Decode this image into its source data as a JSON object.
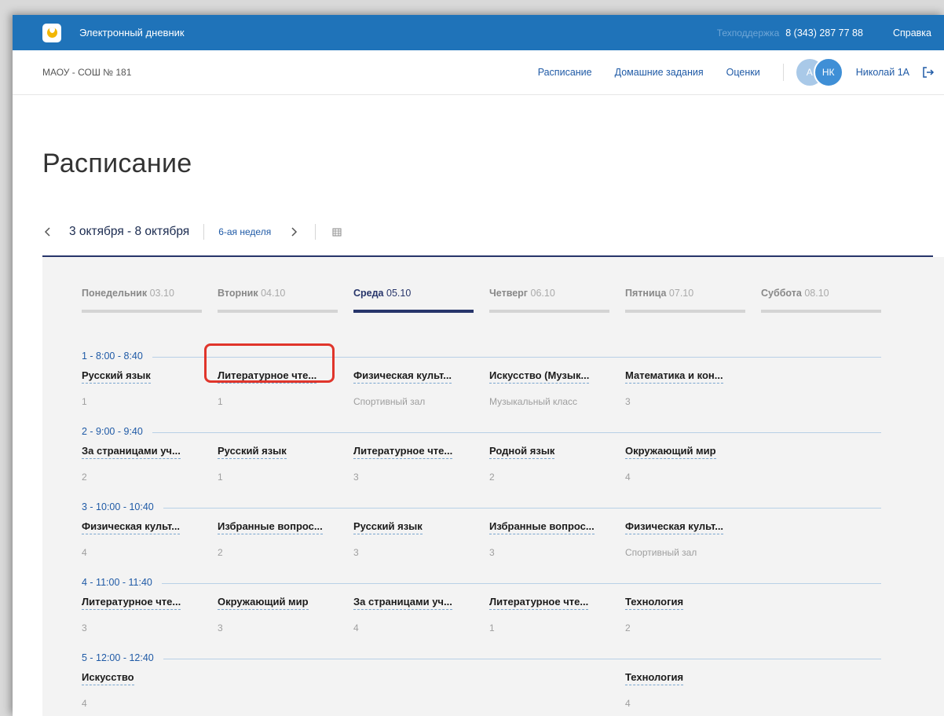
{
  "header": {
    "app_title": "Электронный дневник",
    "support_label": "Техподдержка",
    "support_phone": "8 (343) 287 77 88",
    "help_label": "Справка",
    "brand_color": "#1f73b9"
  },
  "subheader": {
    "school": "МАОУ - СОШ № 181",
    "nav": [
      "Расписание",
      "Домашние задания",
      "Оценки"
    ],
    "avatar_a": "А",
    "avatar_nk": "НК",
    "user_name": "Николай 1А"
  },
  "page": {
    "title": "Расписание",
    "date_range": "3 октября - 8 октября",
    "week_label": "6-ая неделя"
  },
  "days": [
    {
      "name": "Понедельник",
      "date": "03.10"
    },
    {
      "name": "Вторник",
      "date": "04.10"
    },
    {
      "name": "Среда",
      "date": "05.10"
    },
    {
      "name": "Четверг",
      "date": "06.10"
    },
    {
      "name": "Пятница",
      "date": "07.10"
    },
    {
      "name": "Суббота",
      "date": "08.10"
    }
  ],
  "lessons": [
    {
      "label": "1 - 8:00 - 8:40",
      "cells": [
        {
          "subject": "Русский язык",
          "room": "1"
        },
        {
          "subject": "Литературное чте...",
          "room": "1"
        },
        {
          "subject": "Физическая культ...",
          "room": "Спортивный зал"
        },
        {
          "subject": "Искусство (Музык...",
          "room": "Музыкальный класс"
        },
        {
          "subject": "Математика и кон...",
          "room": "3"
        }
      ]
    },
    {
      "label": "2 - 9:00 - 9:40",
      "cells": [
        {
          "subject": "За страницами уч...",
          "room": "2"
        },
        {
          "subject": "Русский язык",
          "room": "1"
        },
        {
          "subject": "Литературное чте...",
          "room": "3"
        },
        {
          "subject": "Родной язык",
          "room": "2"
        },
        {
          "subject": "Окружающий мир",
          "room": "4"
        }
      ]
    },
    {
      "label": "3 - 10:00 - 10:40",
      "cells": [
        {
          "subject": "Физическая культ...",
          "room": "4"
        },
        {
          "subject": "Избранные вопрос...",
          "room": "2"
        },
        {
          "subject": "Русский язык",
          "room": "3"
        },
        {
          "subject": "Избранные вопрос...",
          "room": "3"
        },
        {
          "subject": "Физическая культ...",
          "room": "Спортивный зал"
        }
      ]
    },
    {
      "label": "4 - 11:00 - 11:40",
      "cells": [
        {
          "subject": "Литературное чте...",
          "room": "3"
        },
        {
          "subject": "Окружающий мир",
          "room": "3"
        },
        {
          "subject": "За страницами уч...",
          "room": "4"
        },
        {
          "subject": "Литературное чте...",
          "room": "1"
        },
        {
          "subject": "Технология",
          "room": "2"
        }
      ]
    },
    {
      "label": "5 - 12:00 - 12:40",
      "cells": [
        {
          "subject": "Искусство",
          "room": "4"
        },
        {
          "subject": "",
          "room": ""
        },
        {
          "subject": "",
          "room": ""
        },
        {
          "subject": "",
          "room": ""
        },
        {
          "subject": "Технология",
          "room": "4"
        }
      ]
    }
  ]
}
